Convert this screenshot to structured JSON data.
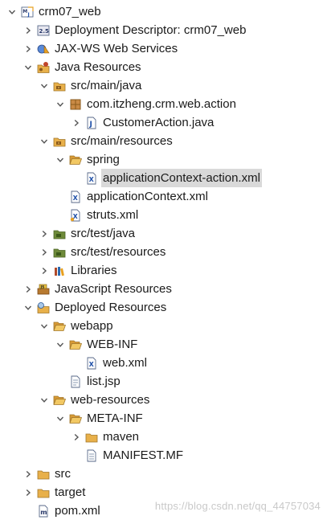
{
  "tree": [
    {
      "label": "crm07_web",
      "level": 0,
      "arrow": "down",
      "icon": "maven-project"
    },
    {
      "label": "Deployment Descriptor: crm07_web",
      "level": 1,
      "arrow": "right",
      "icon": "deployment-descriptor"
    },
    {
      "label": "JAX-WS Web Services",
      "level": 1,
      "arrow": "right",
      "icon": "web-services"
    },
    {
      "label": "Java Resources",
      "level": 1,
      "arrow": "down",
      "icon": "java-resources"
    },
    {
      "label": "src/main/java",
      "level": 2,
      "arrow": "down",
      "icon": "source-folder"
    },
    {
      "label": "com.itzheng.crm.web.action",
      "level": 3,
      "arrow": "down",
      "icon": "package"
    },
    {
      "label": "CustomerAction.java",
      "level": 4,
      "arrow": "right",
      "icon": "java-file"
    },
    {
      "label": "src/main/resources",
      "level": 2,
      "arrow": "down",
      "icon": "source-folder"
    },
    {
      "label": "spring",
      "level": 3,
      "arrow": "down",
      "icon": "folder-open"
    },
    {
      "label": "applicationContext-action.xml",
      "level": 4,
      "arrow": "none",
      "icon": "xml-file",
      "selected": true
    },
    {
      "label": "applicationContext.xml",
      "level": 3,
      "arrow": "none",
      "icon": "xml-file"
    },
    {
      "label": "struts.xml",
      "level": 3,
      "arrow": "none",
      "icon": "xml-file-struts"
    },
    {
      "label": "src/test/java",
      "level": 2,
      "arrow": "right",
      "icon": "test-folder"
    },
    {
      "label": "src/test/resources",
      "level": 2,
      "arrow": "right",
      "icon": "test-folder"
    },
    {
      "label": "Libraries",
      "level": 2,
      "arrow": "right",
      "icon": "libraries"
    },
    {
      "label": "JavaScript Resources",
      "level": 1,
      "arrow": "right",
      "icon": "js-resources"
    },
    {
      "label": "Deployed Resources",
      "level": 1,
      "arrow": "down",
      "icon": "deployed-resources"
    },
    {
      "label": "webapp",
      "level": 2,
      "arrow": "down",
      "icon": "folder-open"
    },
    {
      "label": "WEB-INF",
      "level": 3,
      "arrow": "down",
      "icon": "folder-open"
    },
    {
      "label": "web.xml",
      "level": 4,
      "arrow": "none",
      "icon": "xml-file"
    },
    {
      "label": "list.jsp",
      "level": 3,
      "arrow": "none",
      "icon": "jsp-file"
    },
    {
      "label": "web-resources",
      "level": 2,
      "arrow": "down",
      "icon": "folder-open"
    },
    {
      "label": "META-INF",
      "level": 3,
      "arrow": "down",
      "icon": "folder-open"
    },
    {
      "label": "maven",
      "level": 4,
      "arrow": "right",
      "icon": "folder"
    },
    {
      "label": "MANIFEST.MF",
      "level": 4,
      "arrow": "none",
      "icon": "text-file"
    },
    {
      "label": "src",
      "level": 1,
      "arrow": "right",
      "icon": "folder"
    },
    {
      "label": "target",
      "level": 1,
      "arrow": "right",
      "icon": "folder"
    },
    {
      "label": "pom.xml",
      "level": 1,
      "arrow": "none",
      "icon": "maven-pom-file"
    }
  ],
  "watermark": "https://blog.csdn.net/qq_44757034",
  "colors": {
    "selection": "#d9d9d9",
    "folder": "#e8b04a",
    "package": "#a8672a",
    "java": "#1e4fa8",
    "arrow": "#555555"
  }
}
